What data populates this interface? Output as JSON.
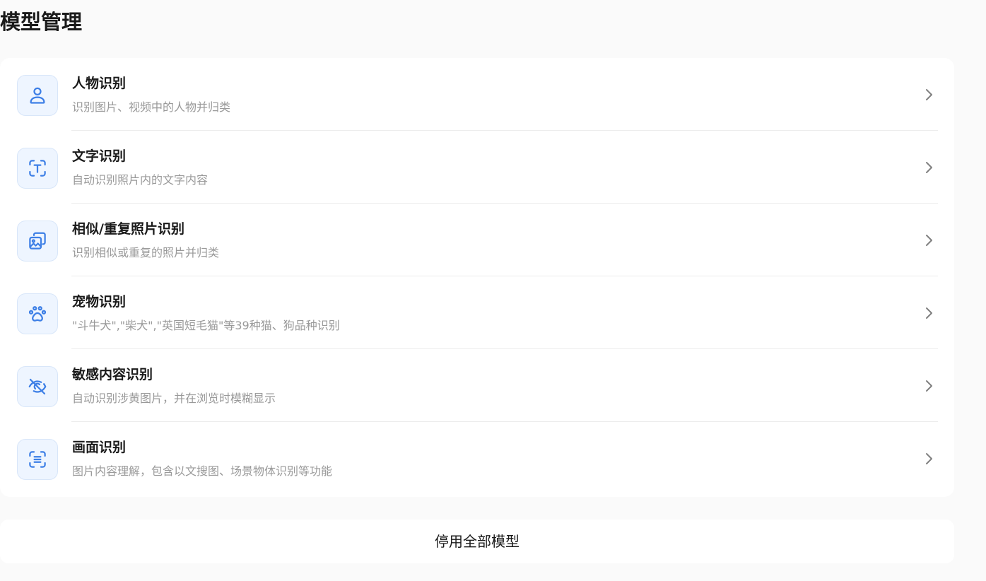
{
  "page": {
    "title": "模型管理"
  },
  "theme": {
    "accent": "#3d7fe6",
    "icon_bg": "#eef5ff",
    "title_color": "#1a1a1a",
    "desc_color": "#999999"
  },
  "models": [
    {
      "title": "人物识别",
      "desc": "识别图片、视频中的人物并归类",
      "icon": "person-icon"
    },
    {
      "title": "文字识别",
      "desc": "自动识别照片内的文字内容",
      "icon": "text-scan-icon"
    },
    {
      "title": "相似/重复照片识别",
      "desc": "识别相似或重复的照片并归类",
      "icon": "duplicate-photos-icon"
    },
    {
      "title": "宠物识别",
      "desc": "\"斗牛犬\",\"柴犬\",\"英国短毛猫\"等39种猫、狗品种识别",
      "icon": "paw-icon"
    },
    {
      "title": "敏感内容识别",
      "desc": "自动识别涉黄图片，并在浏览时模糊显示",
      "icon": "eye-off-icon"
    },
    {
      "title": "画面识别",
      "desc": "图片内容理解，包含以文搜图、场景物体识别等功能",
      "icon": "scene-scan-icon"
    }
  ],
  "actions": {
    "disable_all_label": "停用全部模型"
  }
}
